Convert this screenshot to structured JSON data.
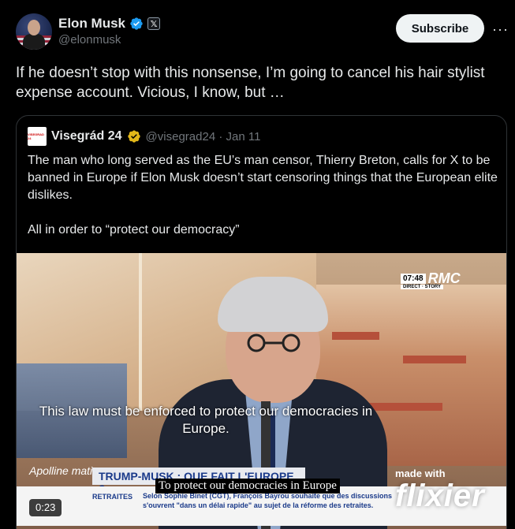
{
  "author": {
    "display_name": "Elon Musk",
    "handle": "@elonmusk",
    "x_badge": "𝕏",
    "verified_icon": "verified-badge-icon"
  },
  "actions": {
    "subscribe_label": "Subscribe",
    "more_label": "···"
  },
  "post": {
    "text": "If he doesn’t stop with this nonsense, I’m going to cancel his hair stylist expense account. Vicious, I know, but …"
  },
  "quoted_post": {
    "display_name": "Visegrád 24",
    "handle_date": "@visegrad24 · Jan 11",
    "avatar_text": "VISEGRAD 24",
    "paragraph_1": "The man who long served as the EU’s man censor, Thierry Breton, calls for X to be banned in Europe if Elon Musk doesn’t start censoring things that the European elite dislikes.",
    "paragraph_2": "All in order to “protect our democracy”"
  },
  "video": {
    "subtitle": "This law must be enforced to protect our democracies in Europe.",
    "rmc_time": "07:48",
    "rmc_logo": "RMC",
    "rmc_sub": "DIRECT · STORY",
    "banner": "TRUMP-MUSK : QUE FAIT L'EUROPE ?",
    "show_name": "Apolline matin",
    "ticker_label": "RETRAITES",
    "ticker_text": "Selon Sophie Binet (CGT), François Bayrou souhaite que des discussions s'ouvrent \"dans un délai rapide\" au sujet de la réforme des retraites.",
    "caption": "To protect our democracies in Europe",
    "watermark_top": "made with",
    "watermark_brand": "flixier",
    "timecode": "0:23"
  }
}
